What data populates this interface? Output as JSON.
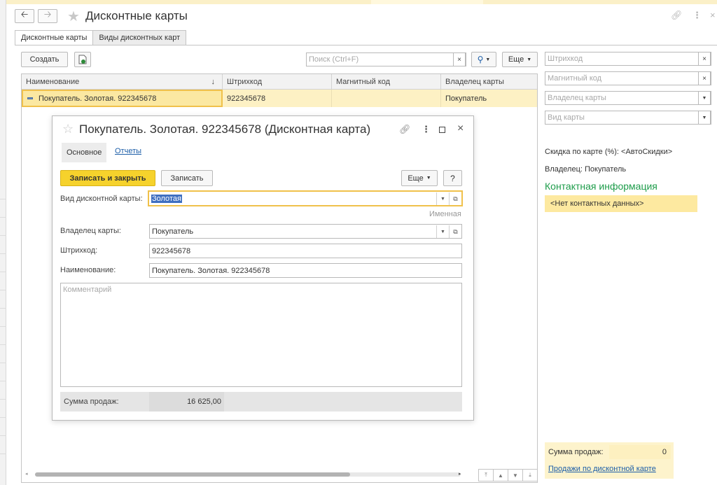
{
  "window": {
    "title": "Дисконтные карты",
    "tabs": [
      {
        "label": "Дисконтные карты",
        "active": true
      },
      {
        "label": "Виды дисконтных карт",
        "active": false
      }
    ]
  },
  "toolbar": {
    "create_label": "Создать",
    "search_placeholder": "Поиск (Ctrl+F)",
    "more_label": "Еще"
  },
  "filters": {
    "barcode_placeholder": "Штрихкод",
    "magnetic_placeholder": "Магнитный код",
    "owner_placeholder": "Владелец карты",
    "card_type_placeholder": "Вид карты"
  },
  "grid": {
    "columns": [
      "Наименование",
      "Штрихкод",
      "Магнитный код",
      "Владелец карты"
    ],
    "sort_indicator": "↓",
    "rows": [
      {
        "name": "Покупатель. Золотая. 922345678",
        "barcode": "922345678",
        "magnetic": "",
        "owner": "Покупатель"
      }
    ]
  },
  "right_panel": {
    "discount_label": "Скидка по карте (%):",
    "discount_value": "<АвтоСкидки>",
    "owner_label": "Владелец:",
    "owner_value": "Покупатель",
    "contact_title": "Контактная информация",
    "contact_empty": "<Нет контактных данных>",
    "sales_label": "Сумма продаж:",
    "sales_value": "0",
    "sales_link": "Продажи по дисконтной карте"
  },
  "modal": {
    "title": "Покупатель. Золотая. 922345678 (Дисконтная карта)",
    "tab_main": "Основное",
    "tab_reports": "Отчеты",
    "save_close_label": "Записать и закрыть",
    "save_label": "Записать",
    "more_label": "Еще",
    "help_label": "?",
    "card_type_label": "Вид дисконтной карты:",
    "card_type_value": "Золотая",
    "card_type_hint": "Именная",
    "owner_label": "Владелец карты:",
    "owner_value": "Покупатель",
    "barcode_label": "Штрихкод:",
    "barcode_value": "922345678",
    "name_label": "Наименование:",
    "name_value": "Покупатель. Золотая. 922345678",
    "comment_placeholder": "Комментарий",
    "sales_label": "Сумма продаж:",
    "sales_value": "16 625,00"
  },
  "icons": {
    "back": "arrow-left-icon",
    "forward": "arrow-right-icon",
    "favorite": "star-icon",
    "link": "link-icon",
    "menu": "kebab-menu-icon",
    "close": "close-icon",
    "maximize": "maximize-icon",
    "search": "magnifier-icon",
    "excel": "spreadsheet-icon"
  },
  "colors": {
    "accent_yellow": "#f6d22c",
    "selection_row": "#fdf1c4",
    "contact_green": "#1d9c4a",
    "link_blue": "#1c5ea8"
  }
}
